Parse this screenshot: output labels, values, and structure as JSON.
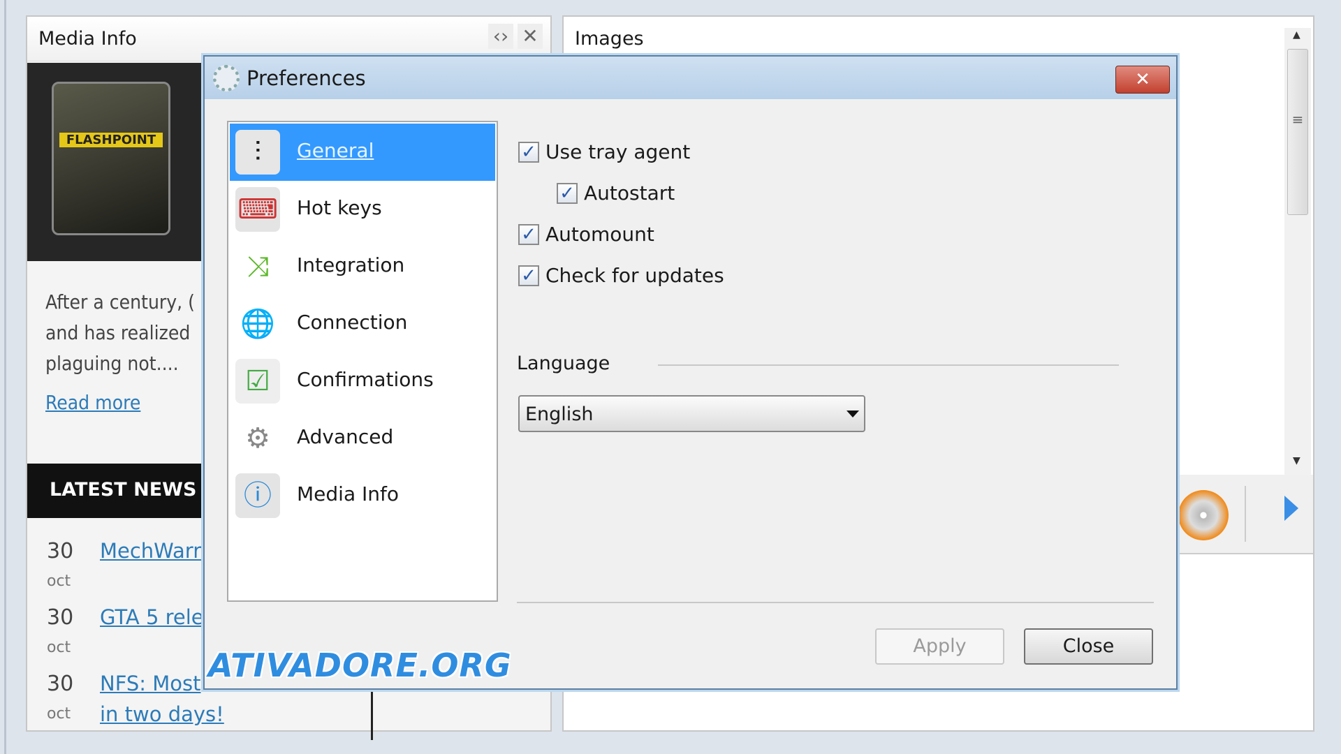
{
  "media_panel": {
    "title": "Media Info",
    "cover_text": "FLASHPOINT",
    "description": [
      "After a century, (",
      "and has realized",
      "plaguing not...."
    ],
    "read_more": "Read more",
    "latest_news": "LATEST NEWS",
    "news": [
      {
        "day": "30",
        "month": "oct",
        "title": "MechWarri"
      },
      {
        "day": "30",
        "month": "oct",
        "title": "GTA 5 rele"
      },
      {
        "day": "30",
        "month": "oct",
        "title": "NFS: Most",
        "title2": "in two days!"
      }
    ]
  },
  "images_panel": {
    "title": "Images"
  },
  "dialog": {
    "title": "Preferences",
    "close": "✕",
    "categories": [
      {
        "label": "General",
        "icon": "general-sliders-icon",
        "selected": true
      },
      {
        "label": "Hot keys",
        "icon": "keyboard-icon"
      },
      {
        "label": "Integration",
        "icon": "integration-arrows-icon"
      },
      {
        "label": "Connection",
        "icon": "globe-network-icon"
      },
      {
        "label": "Confirmations",
        "icon": "checklist-icon"
      },
      {
        "label": "Advanced",
        "icon": "gears-icon"
      },
      {
        "label": "Media Info",
        "icon": "media-info-icon"
      }
    ],
    "options": [
      {
        "label": "Use tray agent",
        "checked": true
      },
      {
        "label": "Autostart",
        "checked": true
      },
      {
        "label": "Automount",
        "checked": true
      },
      {
        "label": "Check for updates",
        "checked": true
      }
    ],
    "language_label": "Language",
    "language_value": "English",
    "apply": "Apply",
    "close_button": "Close"
  },
  "watermark": "ATIVADORE.ORG",
  "colors": {
    "selection": "#3399ff",
    "link": "#2c7bb8",
    "close_red": "#c3402e"
  }
}
